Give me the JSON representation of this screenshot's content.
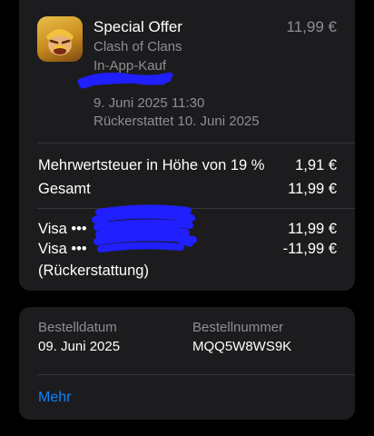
{
  "purchase": {
    "app_icon": "clash-of-clans-barbarian-icon",
    "title": "Special Offer",
    "app_name": "Clash of Clans",
    "purchase_type": "In-App-Kauf",
    "price": "11,99 €",
    "purchase_date": "9. Juni 2025 11:30",
    "refund_date": "Rückerstattet 10. Juni 2025"
  },
  "summary": {
    "vat_label": "Mehrwertsteuer in Höhe von 19 %",
    "vat_value": "1,91 €",
    "total_label": "Gesamt",
    "total_value": "11,99 €"
  },
  "payments": {
    "charge_label": "Visa •••",
    "charge_value": "11,99 €",
    "refund_label": "Visa •••",
    "refund_value": "-11,99 €",
    "refund_note": "(Rückerstattung)"
  },
  "order": {
    "date_label": "Bestelldatum",
    "date_value": "09. Juni 2025",
    "number_label": "Bestellnummer",
    "number_value": "MQQ5W8WS9K",
    "more_link": "Mehr"
  },
  "colors": {
    "background": "#000000",
    "card": "#1c1c1e",
    "secondary_text": "#8e8e93",
    "link": "#0a84ff",
    "redaction": "#1f1fff"
  }
}
